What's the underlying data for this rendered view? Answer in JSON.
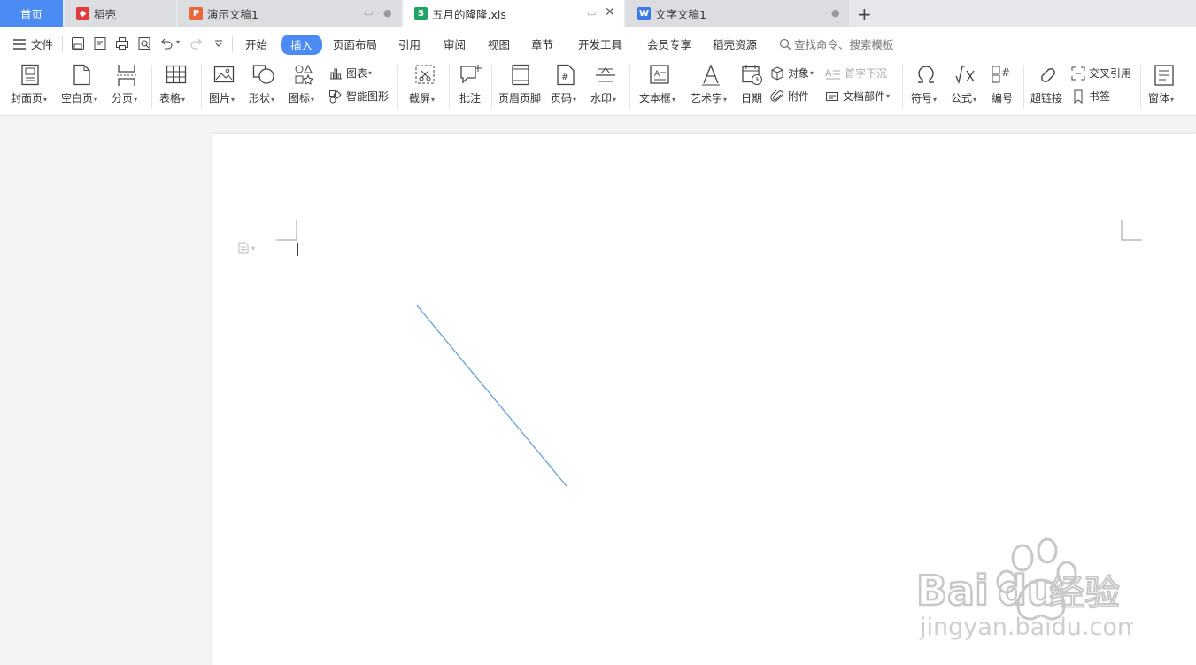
{
  "tabs": {
    "home": "首页",
    "docs": [
      {
        "label": "稻壳",
        "icon": "docer-icon",
        "color": "#e13a3a"
      },
      {
        "label": "演示文稿1",
        "icon": "presentation-icon",
        "color": "#e8683c"
      },
      {
        "label": "五月的隆隆.xls",
        "icon": "spreadsheet-icon",
        "color": "#21a366"
      },
      {
        "label": "文字文稿1",
        "icon": "writer-icon",
        "color": "#3c7ae6"
      }
    ]
  },
  "menu": {
    "file": "文件",
    "items": [
      "开始",
      "插入",
      "页面布局",
      "引用",
      "审阅",
      "视图",
      "章节",
      "开发工具",
      "会员专享",
      "稻壳资源"
    ],
    "active": "插入",
    "search_placeholder": "查找命令、搜索模板"
  },
  "ribbon": {
    "cover": "封面页",
    "blank": "空白页",
    "page_break": "分页",
    "table": "表格",
    "picture": "图片",
    "shape": "形状",
    "icons": "图标",
    "chart": "图表",
    "smart_graphic": "智能图形",
    "screenshot": "截屏",
    "comment": "批注",
    "header_footer": "页眉页脚",
    "page_number": "页码",
    "watermark": "水印",
    "textbox": "文本框",
    "wordart": "艺术字",
    "date": "日期",
    "object": "对象",
    "attachment": "附件",
    "drop_cap": "首字下沉",
    "doc_parts": "文档部件",
    "symbol": "符号",
    "formula": "公式",
    "numbering": "编号",
    "hyperlink": "超链接",
    "cross_ref": "交叉引用",
    "bookmark": "书签",
    "window": "窗体"
  },
  "colors": {
    "accent": "#4a8cf3",
    "line": "#5b9bd5"
  },
  "watermark_text": "Baidu经验",
  "watermark_url": "jingyan.baidu.com"
}
